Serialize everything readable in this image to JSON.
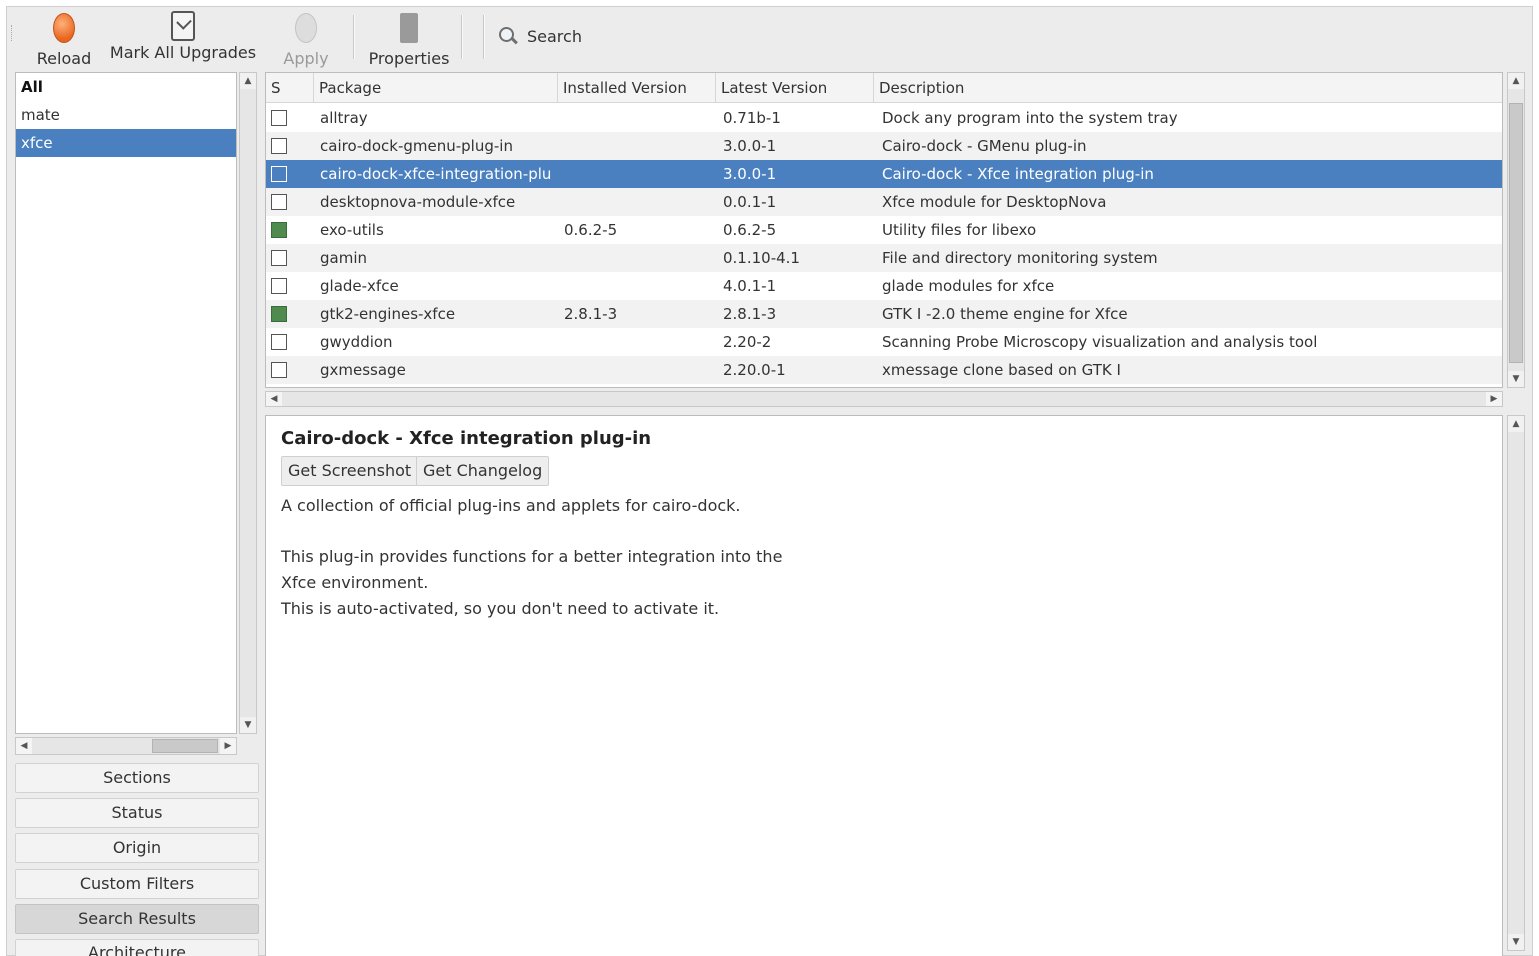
{
  "toolbar": {
    "reload": "Reload",
    "mark_all_upgrades": "Mark All Upgrades",
    "apply": "Apply",
    "properties": "Properties",
    "search": "Search"
  },
  "sections_list": [
    "All",
    "mate",
    "xfce"
  ],
  "selected_section": "xfce",
  "filter_buttons": {
    "sections": "Sections",
    "status": "Status",
    "origin": "Origin",
    "custom_filters": "Custom Filters",
    "search_results": "Search Results",
    "architecture": "Architecture"
  },
  "table": {
    "headers": {
      "s": "S",
      "package": "Package",
      "installed_version": "Installed Version",
      "latest_version": "Latest Version",
      "description": "Description"
    },
    "rows": [
      {
        "package": "alltray",
        "installed": "",
        "latest": "0.71b-1",
        "description": "Dock any program into the system tray",
        "installed_flag": false
      },
      {
        "package": "cairo-dock-gmenu-plug-in",
        "installed": "",
        "latest": "3.0.0-1",
        "description": "Cairo-dock - GMenu plug-in",
        "installed_flag": false
      },
      {
        "package": "cairo-dock-xfce-integration-plu",
        "installed": "",
        "latest": "3.0.0-1",
        "description": "Cairo-dock - Xfce integration plug-in",
        "installed_flag": false
      },
      {
        "package": "desktopnova-module-xfce",
        "installed": "",
        "latest": "0.0.1-1",
        "description": "Xfce module for DesktopNova",
        "installed_flag": false
      },
      {
        "package": "exo-utils",
        "installed": "0.6.2-5",
        "latest": "0.6.2-5",
        "description": "Utility files for libexo",
        "installed_flag": true
      },
      {
        "package": "gamin",
        "installed": "",
        "latest": "0.1.10-4.1",
        "description": "File and directory monitoring system",
        "installed_flag": false
      },
      {
        "package": "glade-xfce",
        "installed": "",
        "latest": "4.0.1-1",
        "description": "glade modules for xfce",
        "installed_flag": false
      },
      {
        "package": "gtk2-engines-xfce",
        "installed": "2.8.1-3",
        "latest": "2.8.1-3",
        "description": "GTK I -2.0 theme engine for Xfce",
        "installed_flag": true
      },
      {
        "package": "gwyddion",
        "installed": "",
        "latest": "2.20-2",
        "description": "Scanning Probe Microscopy visualization and analysis tool",
        "installed_flag": false
      },
      {
        "package": "gxmessage",
        "installed": "",
        "latest": "2.20.0-1",
        "description": "xmessage clone based on GTK I",
        "installed_flag": false
      }
    ],
    "selected_index": 2
  },
  "details": {
    "title": "Cairo-dock - Xfce integration plug-in",
    "get_screenshot": "Get Screenshot",
    "get_changelog": "Get Changelog",
    "summary": "A collection of official plug-ins and applets for cairo-dock.",
    "para_line1": "This plug-in provides functions for a better integration into the",
    "para_line2": "Xfce environment.",
    "para_line3": "This is auto-activated, so you don't need to activate it."
  },
  "icons": {
    "reload": "reload-icon",
    "upgrade": "mark-upgrades-icon",
    "apply": "apply-icon",
    "properties": "properties-icon",
    "search": "search-icon"
  },
  "colors": {
    "selection": "#4a80c0",
    "installed_check": "#4f8a4f"
  }
}
